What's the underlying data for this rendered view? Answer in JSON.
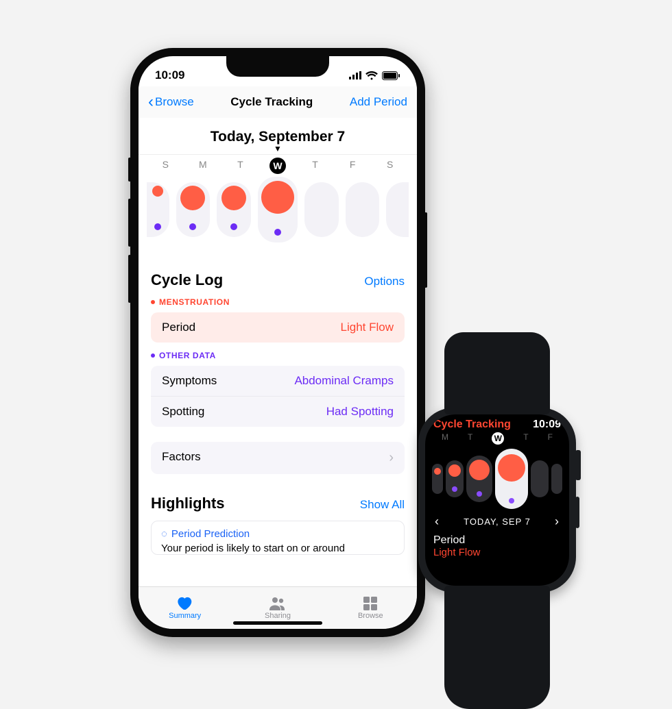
{
  "statusbar": {
    "time": "10:09"
  },
  "navbar": {
    "back": "Browse",
    "title": "Cycle Tracking",
    "action": "Add Period"
  },
  "today": {
    "label": "Today, September 7"
  },
  "weekdays": [
    "S",
    "M",
    "T",
    "W",
    "T",
    "F",
    "S"
  ],
  "cyclelog": {
    "title": "Cycle Log",
    "options": "Options",
    "menstruation_label": "MENSTRUATION",
    "period_row": {
      "label": "Period",
      "value": "Light Flow"
    },
    "other_label": "OTHER DATA",
    "symptoms_row": {
      "label": "Symptoms",
      "value": "Abdominal Cramps"
    },
    "spotting_row": {
      "label": "Spotting",
      "value": "Had Spotting"
    },
    "factors": "Factors"
  },
  "highlights": {
    "title": "Highlights",
    "showall": "Show All",
    "pred_title": "Period Prediction",
    "pred_desc": "Your period is likely to start on or around"
  },
  "tabbar": {
    "summary": "Summary",
    "sharing": "Sharing",
    "browse": "Browse"
  },
  "watch": {
    "title": "Cycle Tracking",
    "time": "10:09",
    "days": [
      "M",
      "T",
      "W",
      "T",
      "F"
    ],
    "date": "TODAY, SEP 7",
    "foot_label": "Period",
    "foot_value": "Light Flow"
  }
}
